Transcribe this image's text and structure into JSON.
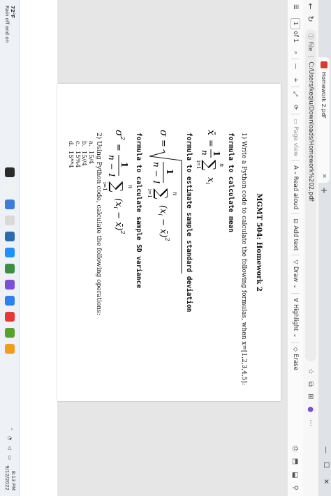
{
  "browser": {
    "tab_title": "Homework 2.pdf",
    "tab_close": "×",
    "new_tab": "+",
    "window_controls": [
      "—",
      "☐",
      "✕"
    ],
    "address_prefix": "File",
    "url": "C:/Users/keqiu/Downloads/Homework%202.pdf"
  },
  "pdf_toolbar": {
    "sidebar_toggle": "☰",
    "page_current": "1",
    "page_total": "of 1",
    "search": "⌕",
    "zoom_out": "—",
    "zoom_in": "+",
    "fit": "⤢",
    "rotate": "⟳",
    "page_view": "Page view",
    "read_aloud": "Read aloud",
    "add_text": "Add text",
    "draw": "Draw",
    "highlight": "Highlight",
    "erase": "Erase"
  },
  "document": {
    "title": "MGMT 504: Homework 2",
    "q1": "1)  Write a Python code to calculate the following formulas, when x=[1,2,3,4,5]:",
    "f1_label": "formula to calculate mean",
    "f2_label": "formula to estimate sample standard deviation",
    "f3_label": "formula to calculate sample SD variance",
    "q2": "2)  Using Python code, calculate the following operations:",
    "ops": [
      {
        "label": "a.",
        "expr": "15/4"
      },
      {
        "label": "b.",
        "expr": "15//4"
      },
      {
        "label": "c.",
        "expr": "15%4"
      },
      {
        "label": "d.",
        "expr": "15**4"
      }
    ]
  },
  "taskbar": {
    "temp": "72°F",
    "weather_text": "Rain off and on",
    "time": "8:13 PM",
    "date": "9/12/2022",
    "icon_colors": [
      "#2b2b2b",
      "#f2f2f2",
      "#3b7dd8",
      "#d9d9d9",
      "#2b6cb0",
      "#1e90ff",
      "#3e8e41",
      "#7b4fd6",
      "#2f80ed",
      "#e53935",
      "#5aa02c",
      "#f29b1d"
    ]
  }
}
